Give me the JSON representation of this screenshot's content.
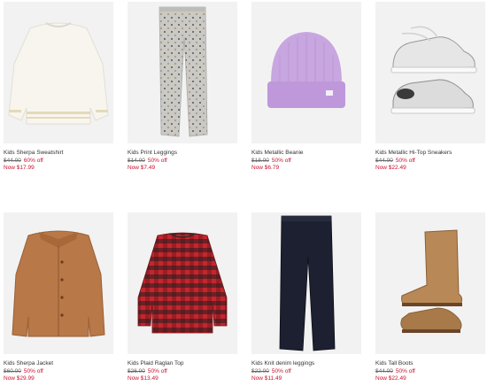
{
  "products": [
    {
      "name": "Kids Sherpa Sweatshirt",
      "was": "$44.00",
      "off": "60% off",
      "now": "Now $17.99",
      "image_icon": "sherpa-sweatshirt-icon"
    },
    {
      "name": "Kids Print Leggings",
      "was": "$14.00",
      "off": "50% off",
      "now": "Now $7.49",
      "image_icon": "print-leggings-icon"
    },
    {
      "name": "Kids Metallic Beanie",
      "was": "$18.00",
      "off": "50% off",
      "now": "Now $6.79",
      "image_icon": "beanie-icon"
    },
    {
      "name": "Kids Metallic Hi-Top Sneakers",
      "was": "$44.00",
      "off": "50% off",
      "now": "Now $22.49",
      "image_icon": "sneakers-icon"
    },
    {
      "name": "Kids Sherpa Jacket",
      "was": "$60.00",
      "off": "50% off",
      "now": "Now $29.99",
      "image_icon": "sherpa-jacket-icon"
    },
    {
      "name": "Kids Plaid Raglan Top",
      "was": "$26.00",
      "off": "50% off",
      "now": "Now $13.49",
      "image_icon": "plaid-top-icon"
    },
    {
      "name": "Kids Knit denim leggings",
      "was": "$22.00",
      "off": "50% off",
      "now": "Now $11.49",
      "image_icon": "denim-leggings-icon"
    },
    {
      "name": "Kids Tall Boots",
      "was": "$44.00",
      "off": "50% off",
      "now": "Now $22.49",
      "image_icon": "tall-boots-icon"
    }
  ],
  "colors": {
    "sale_red": "#c8102e",
    "image_bg": "#f2f2f2",
    "text": "#333333"
  }
}
